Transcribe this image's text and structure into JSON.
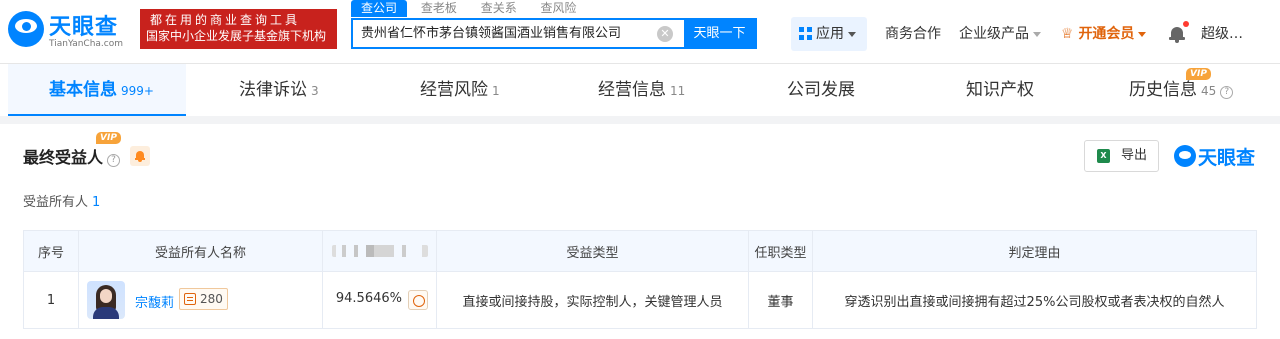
{
  "header": {
    "logo_cn": "天眼查",
    "logo_en": "TianYanCha.com",
    "promo_line1": "都在用的商业查询工具",
    "promo_line2": "国家中小企业发展子基金旗下机构",
    "search_tabs": [
      "查公司",
      "查老板",
      "查关系",
      "查风险"
    ],
    "search_value": "贵州省仁怀市茅台镇领酱国酒业销售有限公司",
    "search_button": "天眼一下",
    "nav_app": "应用",
    "nav_business": "商务合作",
    "nav_enterprise": "企业级产品",
    "nav_vip": "开通会员",
    "nav_user": "超级…"
  },
  "tabs": [
    {
      "label": "基本信息",
      "count": "999+",
      "active": true
    },
    {
      "label": "法律诉讼",
      "count": "3"
    },
    {
      "label": "经营风险",
      "count": "1"
    },
    {
      "label": "经营信息",
      "count": "11"
    },
    {
      "label": "公司发展",
      "count": ""
    },
    {
      "label": "知识产权",
      "count": ""
    },
    {
      "label": "历史信息",
      "count": "45",
      "vip": "VIP"
    }
  ],
  "section": {
    "title": "最终受益人",
    "vip": "VIP",
    "export_label": "导出",
    "brand": "天眼查",
    "subtitle": "受益所有人",
    "subtitle_count": "1"
  },
  "table": {
    "headers": [
      "序号",
      "受益所有人名称",
      "",
      "受益类型",
      "任职类型",
      "判定理由"
    ],
    "rows": [
      {
        "index": "1",
        "name": "宗馥莉",
        "tag_count": "280",
        "percent": "94.5646%",
        "benefit_type": "直接或间接持股，实际控制人，关键管理人员",
        "position_type": "董事",
        "reason": "穿透识别出直接或间接拥有超过25%公司股权或者表决权的自然人"
      }
    ]
  },
  "colors": {
    "brand_blue": "#0084ff",
    "promo_red": "#c8221d",
    "vip_orange": "#e0640c"
  },
  "icons": [
    "search-clear-icon",
    "app-grid-icon",
    "crown-icon",
    "bell-icon",
    "help-icon",
    "excel-icon",
    "avatar"
  ]
}
